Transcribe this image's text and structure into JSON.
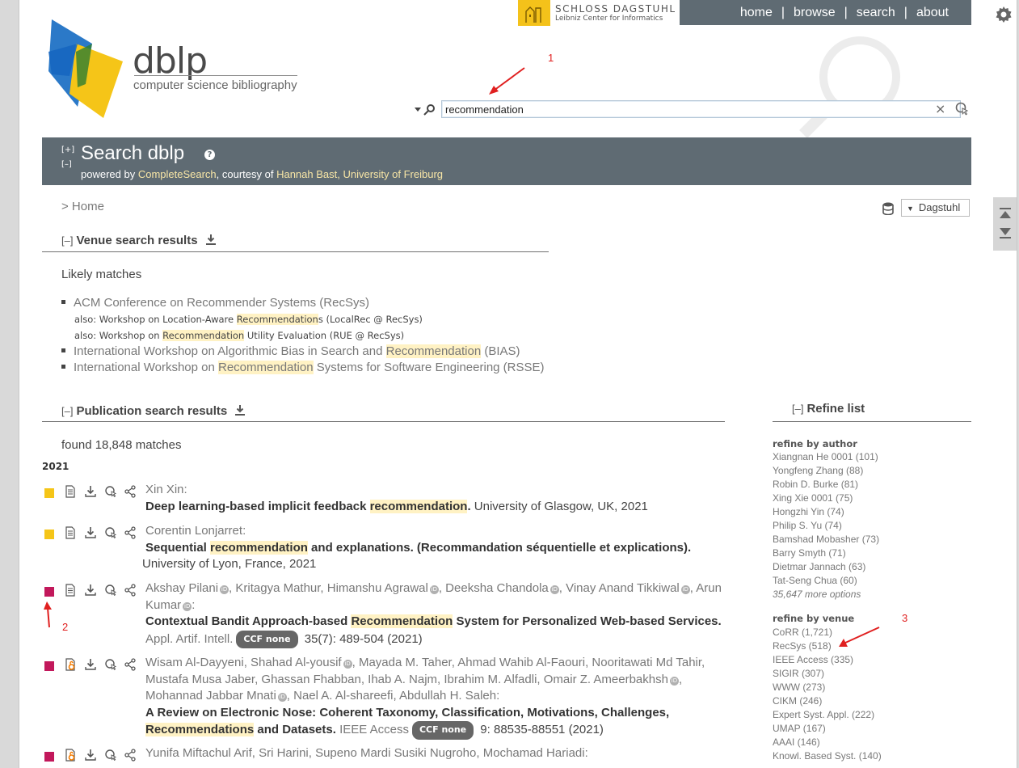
{
  "topnav": {
    "dagstuhl_line1": "SCHLOSS DAGSTUHL",
    "dagstuhl_line2": "Leibniz Center for Informatics",
    "items": [
      "home",
      "browse",
      "search",
      "about"
    ],
    "separator": "|"
  },
  "logo": {
    "word": "dblp",
    "subtitle": "computer science bibliography"
  },
  "search": {
    "value": "recommendation",
    "clear": "×"
  },
  "header": {
    "expand": "[+]",
    "collapse": "[–]",
    "title": "Search dblp",
    "powered_prefix": "powered by ",
    "powered_link": "CompleteSearch",
    "courtesy_text": ", courtesy of ",
    "courtesy_link": "Hannah Bast, University of Freiburg"
  },
  "breadcrumb": "> Home",
  "mirror": "Dagstuhl",
  "venue_results": {
    "toggle": "[–]",
    "heading": "Venue search results",
    "likely": "Likely matches",
    "items": [
      {
        "pre": "ACM Conference on Recommender Systems (RecSys)",
        "hl": "",
        "post": ""
      },
      {
        "pre": "International Workshop on Algorithmic Bias in Search and ",
        "hl": "Recommendation",
        "post": " (BIAS)"
      },
      {
        "pre": "International Workshop on ",
        "hl": "Recommendation",
        "post": " Systems for Software Engineering (RSSE)"
      }
    ],
    "also": [
      {
        "pre": "also: Workshop on Location-Aware ",
        "hl": "Recommendation",
        "post": "s (LocalRec @ RecSys)"
      },
      {
        "pre": "also: Workshop on ",
        "hl": "Recommendation",
        "post": " Utility Evaluation (RUE @ RecSys)"
      }
    ]
  },
  "pub_results": {
    "toggle": "[–]",
    "heading": "Publication search results",
    "found": "found 18,848 matches",
    "year": "2021",
    "ccf": "CCF none",
    "pubs": [
      {
        "color": "#f5c518",
        "authors": "Xin Xin:",
        "title_pre": "Deep learning-based implicit feedback ",
        "title_hl": "recommendation",
        "title_post": ".",
        "venue": " University of Glasgow, UK, 2021"
      },
      {
        "color": "#f5c518",
        "authors": "Corentin Lonjarret:",
        "title_pre": "Sequential ",
        "title_hl": "recommendation",
        "title_post": " and explanations. (Recommandation séquentielle et explications).",
        "venue": " University of Lyon, France, 2021"
      },
      {
        "color": "#c2185b",
        "authors_parts": [
          "Akshay Pilani",
          ", Kritagya Mathur, Himanshu Agrawal",
          ", Deeksha Chandola",
          ", Vinay Anand Tikkiwal",
          ", Arun Kumar",
          ":"
        ],
        "title_pre": "Contextual Bandit Approach-based ",
        "title_hl": "Recommendation",
        "title_post": " System for Personalized Web-based Services.",
        "venue_name": " Appl. Artif. Intell.",
        "venue_post": " 35(7): 489-504 (2021)"
      },
      {
        "color": "#c2185b",
        "authors_parts": [
          "Wisam Al-Dayyeni, Shahad Al-yousif",
          ", Mayada M. Taher, Ahmad Wahib Al-Faouri, Nooritawati Md Tahir, Mustafa Musa Jaber, Ghassan Fhabban, Ihab A. Najm, Ibrahim M. Alfadli, Omair Z. Ameerbakhsh",
          ", Mohannad Jabbar Mnati",
          ", Nael A. Al-shareefi, Abdullah H. Saleh:"
        ],
        "title_pre": "A Review on Electronic Nose: Coherent Taxonomy, Classification, Motivations, Challenges, ",
        "title_hl": "Recommendations",
        "title_post": " and Datasets.",
        "venue_name": " IEEE Access",
        "venue_post": " 9: 88535-88551 (2021)"
      },
      {
        "color": "#c2185b",
        "authors": "Yunifa Miftachul Arif, Sri Harini, Supeno Mardi Susiki Nugroho, Mochamad Hariadi:"
      }
    ]
  },
  "refine": {
    "toggle": "[–]",
    "heading": "Refine list",
    "by_author": "refine by author",
    "authors": [
      "Xiangnan He 0001 (101)",
      "Yongfeng Zhang (88)",
      "Robin D. Burke (81)",
      "Xing Xie 0001 (75)",
      "Hongzhi Yin (74)",
      "Philip S. Yu (74)",
      "Bamshad Mobasher (73)",
      "Barry Smyth (71)",
      "Dietmar Jannach (63)",
      "Tat-Seng Chua (60)"
    ],
    "more_authors": "35,647 more options",
    "by_venue": "refine by venue",
    "venues": [
      "CoRR (1,721)",
      "RecSys (518)",
      "IEEE Access (335)",
      "SIGIR (307)",
      "WWW (273)",
      "CIKM (246)",
      "Expert Syst. Appl. (222)",
      "UMAP (167)",
      "AAAI (146)",
      "Knowl. Based Syst. (140)"
    ]
  },
  "annotations": [
    "1",
    "2",
    "3"
  ]
}
